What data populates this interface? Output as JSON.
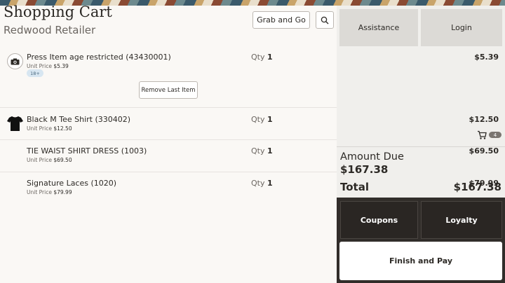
{
  "header": {
    "title": "Shopping Cart",
    "retailer": "Redwood Retailer",
    "grab_and_go_label": "Grab and Go"
  },
  "items": [
    {
      "name": "Press Item age restricted (43430001)",
      "unit_label": "Unit Price",
      "unit_price": "$5.39",
      "qty_label": "Qty",
      "qty": "1",
      "price": "$5.39",
      "badge": "18+",
      "icon": "camera-icon"
    },
    {
      "name": "Black M Tee Shirt (330402)",
      "unit_label": "Unit Price",
      "unit_price": "$12.50",
      "qty_label": "Qty",
      "qty": "1",
      "price": "$12.50",
      "icon": "tshirt-icon"
    },
    {
      "name": "TIE WAIST SHIRT DRESS (1003)",
      "unit_label": "Unit Price",
      "unit_price": "$69.50",
      "qty_label": "Qty",
      "qty": "1",
      "price": "$69.50"
    },
    {
      "name": "Signature Laces (1020)",
      "unit_label": "Unit Price",
      "unit_price": "$79.99",
      "qty_label": "Qty",
      "qty": "1",
      "price": "$79.99"
    }
  ],
  "remove_last_item_label": "Remove Last Item",
  "side": {
    "assistance_label": "Assistance",
    "login_label": "Login",
    "cart_count": "4",
    "amount_due_label": "Amount Due",
    "amount_due": "$167.38",
    "total_label": "Total",
    "total": "$167.38",
    "coupons_label": "Coupons",
    "loyalty_label": "Loyalty",
    "finish_label": "Finish and Pay"
  },
  "colors": {
    "background": "#faf8f5",
    "side_panel": "#f0efec",
    "dark_panel": "#312d2a",
    "badge_blue": "#d7e6f1"
  }
}
